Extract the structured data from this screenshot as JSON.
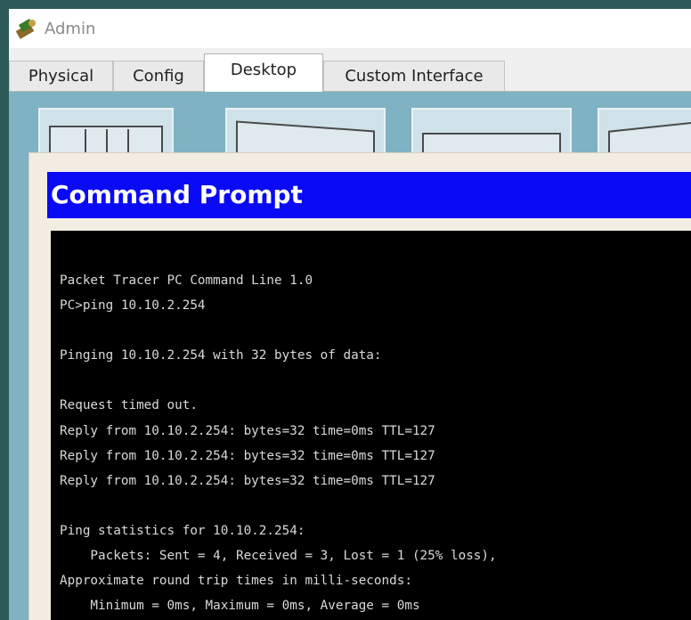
{
  "window": {
    "title": "Admin",
    "icon": "packet-tracer-pc-icon"
  },
  "tabs": [
    {
      "label": "Physical",
      "active": false
    },
    {
      "label": "Config",
      "active": false
    },
    {
      "label": "Desktop",
      "active": true
    },
    {
      "label": "Custom Interface",
      "active": false
    }
  ],
  "desktop_icons": [
    "ip-configuration-icon",
    "dial-up-icon",
    "terminal-icon",
    "command-prompt-icon"
  ],
  "command_prompt": {
    "title": "Command Prompt",
    "lines": [
      "Packet Tracer PC Command Line 1.0",
      "PC>ping 10.10.2.254",
      "",
      "Pinging 10.10.2.254 with 32 bytes of data:",
      "",
      "Request timed out.",
      "Reply from 10.10.2.254: bytes=32 time=0ms TTL=127",
      "Reply from 10.10.2.254: bytes=32 time=0ms TTL=127",
      "Reply from 10.10.2.254: bytes=32 time=0ms TTL=127",
      "",
      "Ping statistics for 10.10.2.254:",
      "    Packets: Sent = 4, Received = 3, Lost = 1 (25% loss),",
      "Approximate round trip times in milli-seconds:",
      "    Minimum = 0ms, Maximum = 0ms, Average = 0ms"
    ]
  },
  "colors": {
    "background": "#2d5a58",
    "desktop": "#7fb2c3",
    "cmd_title_bar": "#0a0af5",
    "terminal_bg": "#000000",
    "terminal_fg": "#d9d9d9"
  }
}
